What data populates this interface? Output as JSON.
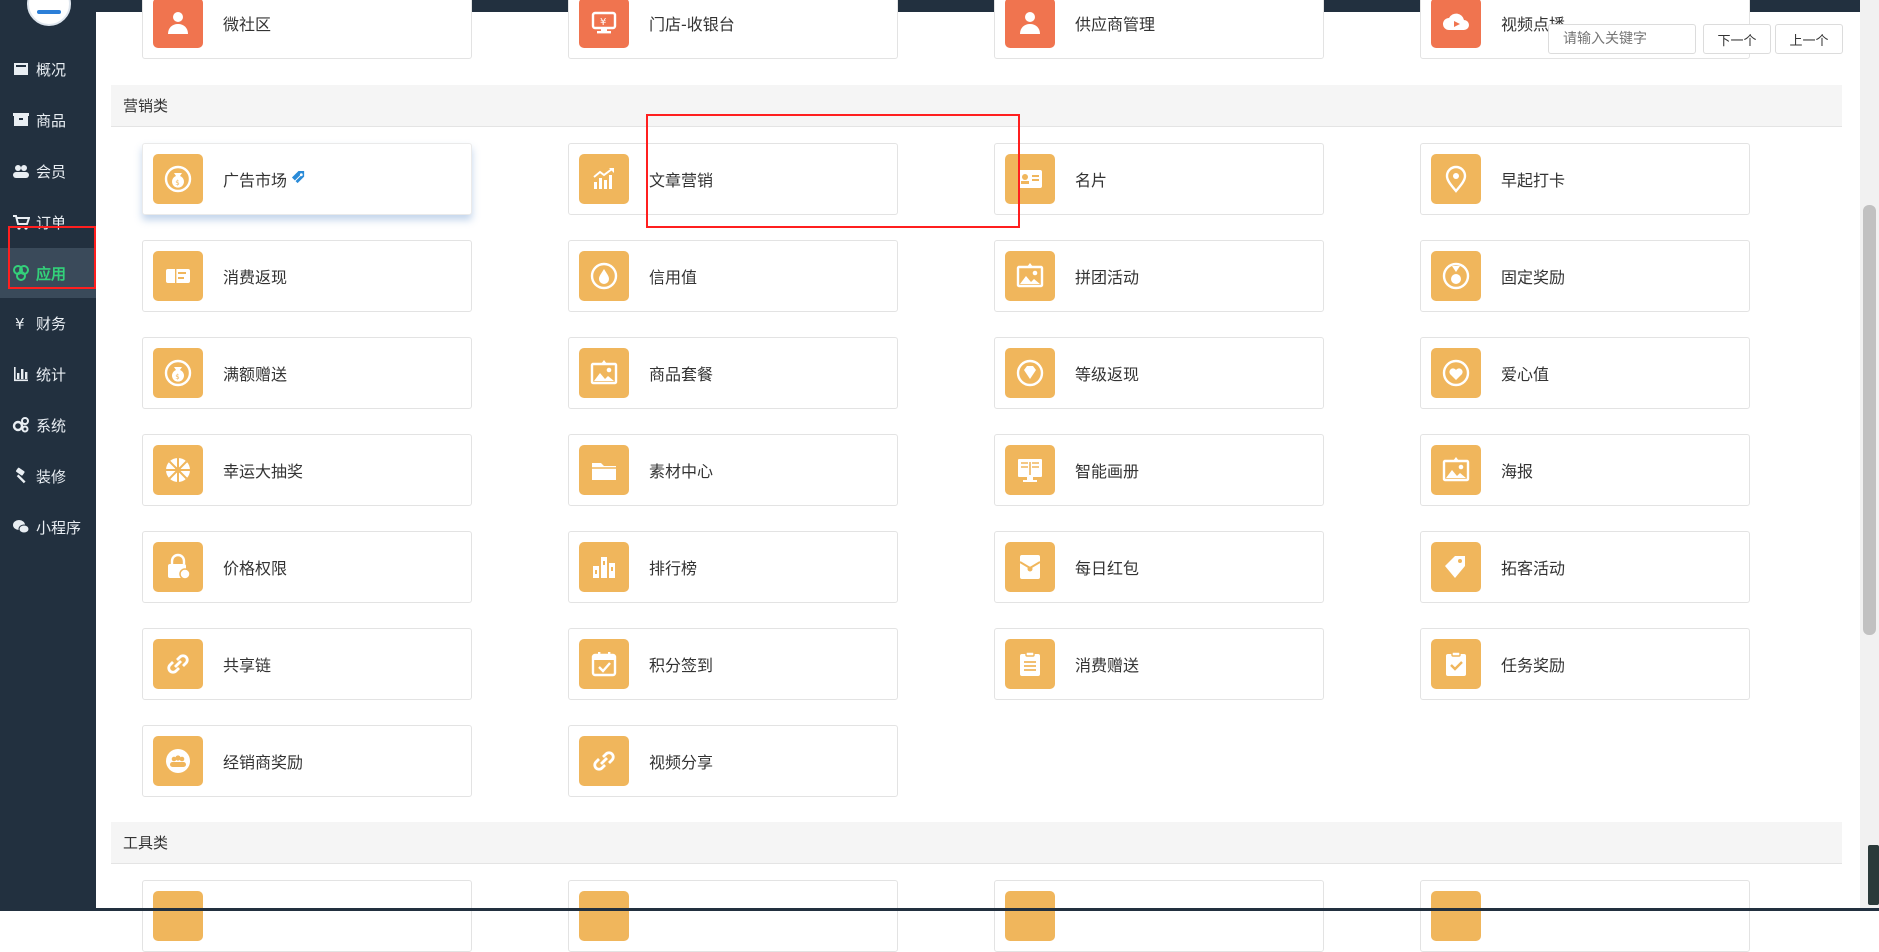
{
  "sidebar": {
    "items": [
      {
        "label": "概况",
        "icon": "dashboard-icon"
      },
      {
        "label": "商品",
        "icon": "box-icon"
      },
      {
        "label": "会员",
        "icon": "users-icon"
      },
      {
        "label": "订单",
        "icon": "cart-icon"
      },
      {
        "label": "应用",
        "icon": "apps-icon",
        "active": true
      },
      {
        "label": "财务",
        "icon": "yen-icon"
      },
      {
        "label": "统计",
        "icon": "bar-chart-icon"
      },
      {
        "label": "系统",
        "icon": "gears-icon"
      },
      {
        "label": "装修",
        "icon": "hammer-icon"
      },
      {
        "label": "小程序",
        "icon": "wechat-icon"
      }
    ],
    "active_color": "#33d17a"
  },
  "search": {
    "placeholder": "请输入关键字",
    "next_label": "下一个",
    "prev_label": "上一个"
  },
  "top_row": [
    {
      "label": "微社区",
      "icon": "community-icon"
    },
    {
      "label": "门店-收银台",
      "icon": "cashier-icon"
    },
    {
      "label": "供应商管理",
      "icon": "supplier-icon"
    },
    {
      "label": "视频点播",
      "icon": "cloud-video-icon"
    }
  ],
  "sections": [
    {
      "title": "营销类",
      "items": [
        {
          "label": "广告市场",
          "icon": "money-bag-icon",
          "tag": "tag-icon"
        },
        {
          "label": "文章营销",
          "icon": "growth-chart-icon"
        },
        {
          "label": "名片",
          "icon": "business-card-icon"
        },
        {
          "label": "早起打卡",
          "icon": "location-pin-icon"
        },
        {
          "label": "消费返现",
          "icon": "ticket-icon"
        },
        {
          "label": "信用值",
          "icon": "drop-icon"
        },
        {
          "label": "拼团活动",
          "icon": "photo-icon"
        },
        {
          "label": "固定奖励",
          "icon": "medal-icon"
        },
        {
          "label": "满额赠送",
          "icon": "money-bag-icon"
        },
        {
          "label": "商品套餐",
          "icon": "photo-icon"
        },
        {
          "label": "等级返现",
          "icon": "diamond-icon"
        },
        {
          "label": "爱心值",
          "icon": "heart-icon"
        },
        {
          "label": "幸运大抽奖",
          "icon": "wheel-icon"
        },
        {
          "label": "素材中心",
          "icon": "folder-icon"
        },
        {
          "label": "智能画册",
          "icon": "book-screen-icon"
        },
        {
          "label": "海报",
          "icon": "photo-icon"
        },
        {
          "label": "价格权限",
          "icon": "lock-bag-icon"
        },
        {
          "label": "排行榜",
          "icon": "ranking-icon"
        },
        {
          "label": "每日红包",
          "icon": "envelope-icon"
        },
        {
          "label": "拓客活动",
          "icon": "price-tag-icon"
        },
        {
          "label": "共享链",
          "icon": "link-icon"
        },
        {
          "label": "积分签到",
          "icon": "calendar-check-icon"
        },
        {
          "label": "消费赠送",
          "icon": "clipboard-icon"
        },
        {
          "label": "任务奖励",
          "icon": "clipboard-check-icon"
        },
        {
          "label": "经销商奖励",
          "icon": "group-icon"
        },
        {
          "label": "视频分享",
          "icon": "link-icon"
        }
      ]
    },
    {
      "title": "工具类",
      "items": []
    }
  ],
  "colors": {
    "sidebar_bg": "#22303f",
    "icon_orange": "#f0b65c",
    "icon_red": "#f0744f",
    "highlight_red": "#ff1f1f"
  }
}
